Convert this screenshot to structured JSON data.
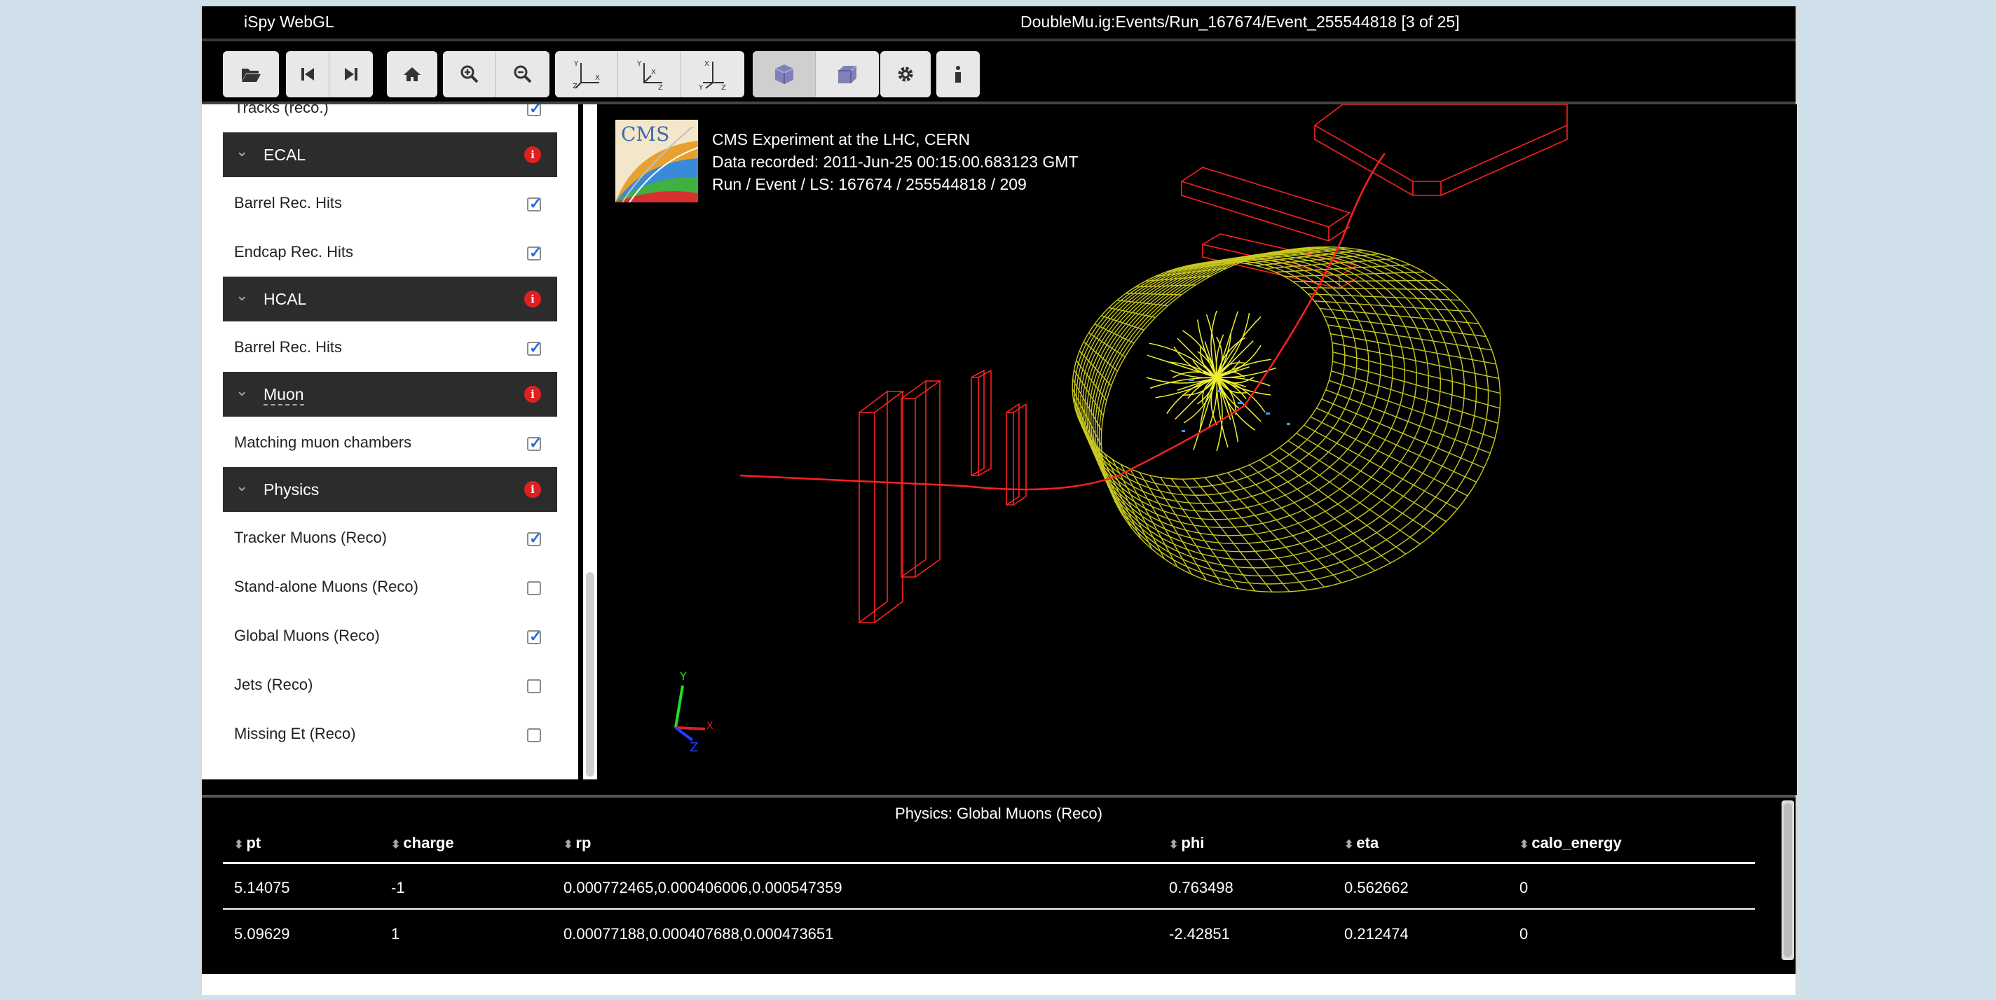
{
  "titlebar": {
    "app_title": "iSpy WebGL",
    "event_title": "DoubleMu.ig:Events/Run_167674/Event_255544818 [3 of 25]"
  },
  "toolbar": {
    "buttons": [
      "open-file",
      "previous-event",
      "next-event",
      "reset-view",
      "zoom-in",
      "zoom-out",
      "view-xy",
      "view-zx",
      "view-yz",
      "perspective",
      "orthographic",
      "settings",
      "info"
    ]
  },
  "sidebar": {
    "partial_item": "Tracks (reco.)",
    "sections": [
      {
        "title": "ECAL",
        "items": [
          {
            "label": "Barrel Rec. Hits",
            "checked": true
          },
          {
            "label": "Endcap Rec. Hits",
            "checked": true
          }
        ]
      },
      {
        "title": "HCAL",
        "items": [
          {
            "label": "Barrel Rec. Hits",
            "checked": true
          }
        ]
      },
      {
        "title": "Muon",
        "items": [
          {
            "label": "Matching muon chambers",
            "checked": true
          }
        ]
      },
      {
        "title": "Physics",
        "items": [
          {
            "label": "Tracker Muons (Reco)",
            "checked": true
          },
          {
            "label": "Stand-alone Muons (Reco)",
            "checked": false
          },
          {
            "label": "Global Muons (Reco)",
            "checked": true
          },
          {
            "label": "Jets (Reco)",
            "checked": false
          },
          {
            "label": "Missing Et (Reco)",
            "checked": false
          }
        ]
      }
    ]
  },
  "viewer": {
    "logo_text": "CMS",
    "info_lines": [
      "CMS Experiment at the LHC, CERN",
      "Data recorded: 2011-Jun-25 00:15:00.683123 GMT",
      "Run / Event / LS: 167674 / 255544818 / 209"
    ],
    "axes": {
      "x": "X",
      "y": "Y",
      "z": "Z"
    }
  },
  "table": {
    "title": "Physics: Global Muons (Reco)",
    "columns": [
      "pt",
      "charge",
      "rp",
      "phi",
      "eta",
      "calo_energy"
    ],
    "rows": [
      [
        "5.14075",
        "-1",
        "0.000772465,0.000406006,0.000547359",
        "0.763498",
        "0.562662",
        "0"
      ],
      [
        "5.09629",
        "1",
        "0.00077188,0.000407688,0.000473651",
        "-2.42851",
        "0.212474",
        "0"
      ]
    ]
  },
  "colors": {
    "track": "#ff2020",
    "ecal": "#d8d820",
    "chamber": "#ff2020",
    "info_badge": "#e02020"
  }
}
